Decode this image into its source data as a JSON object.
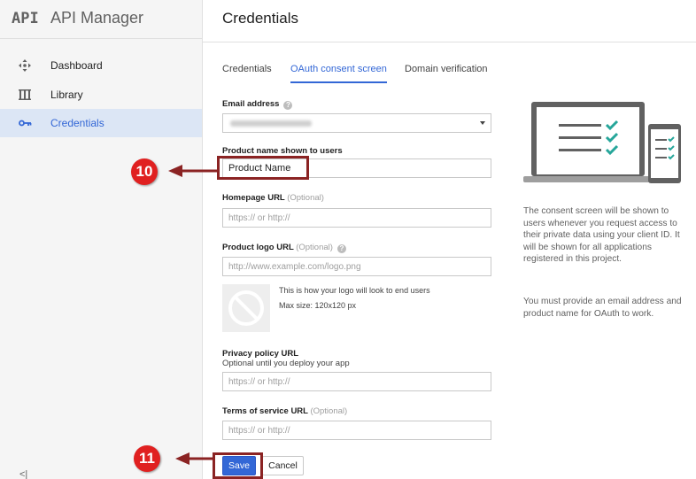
{
  "app": {
    "logo": "API",
    "name": "API Manager"
  },
  "sidebar": {
    "items": [
      {
        "label": "Dashboard",
        "icon": "dashboard-icon",
        "active": false
      },
      {
        "label": "Library",
        "icon": "library-icon",
        "active": false
      },
      {
        "label": "Credentials",
        "icon": "key-icon",
        "active": true
      }
    ],
    "collapse_label": "<|"
  },
  "header": {
    "title": "Credentials"
  },
  "tabs": [
    {
      "label": "Credentials",
      "active": false
    },
    {
      "label": "OAuth consent screen",
      "active": true
    },
    {
      "label": "Domain verification",
      "active": false
    }
  ],
  "form": {
    "email": {
      "label": "Email address"
    },
    "product_name": {
      "label": "Product name shown to users",
      "value": "Product Name"
    },
    "homepage": {
      "label": "Homepage URL",
      "optional": "(Optional)",
      "placeholder": "https:// or http://"
    },
    "logo_url": {
      "label": "Product logo URL",
      "optional": "(Optional)",
      "placeholder": "http://www.example.com/logo.png"
    },
    "logo_note": {
      "line1": "This is how your logo will look to end users",
      "line2": "Max size: 120x120 px"
    },
    "privacy": {
      "label": "Privacy policy URL",
      "sublabel": "Optional until you deploy your app",
      "placeholder": "https:// or http://"
    },
    "terms": {
      "label": "Terms of service URL",
      "optional": "(Optional)",
      "placeholder": "https:// or http://"
    },
    "save_label": "Save",
    "cancel_label": "Cancel"
  },
  "info": {
    "paragraph1": "The consent screen will be shown to users whenever you request access to their private data using your client ID. It will be shown for all applications registered in this project.",
    "paragraph2": "You must provide an email address and product name for OAuth to work."
  },
  "annotations": {
    "step1": "10",
    "step2": "11"
  },
  "colors": {
    "accent": "#3367d6",
    "annotation": "#e02020",
    "highlight": "#8b2323",
    "check": "#26a69a"
  }
}
